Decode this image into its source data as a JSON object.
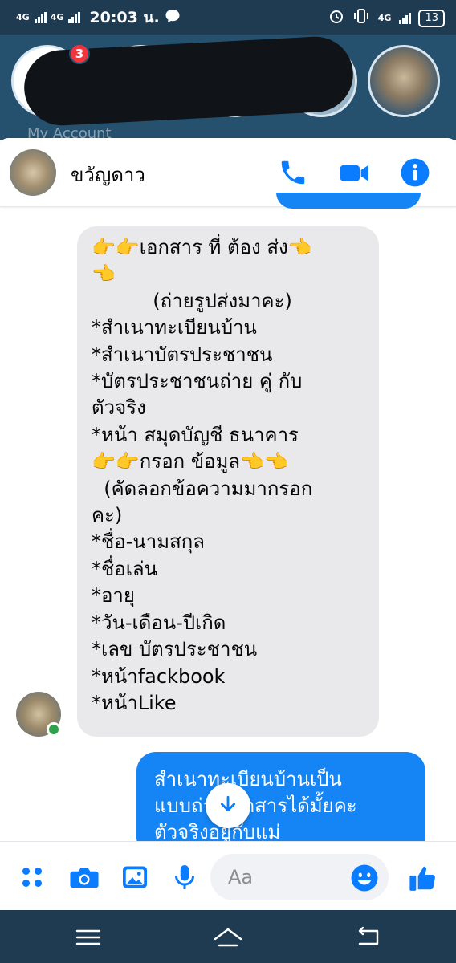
{
  "status_bar": {
    "network_1": "4G",
    "network_2": "4G",
    "time": "20:03 น.",
    "network_right": "4G",
    "battery": "13"
  },
  "stories": {
    "unread_badge": "3",
    "my_account_label": "My Account"
  },
  "chat": {
    "contact_name": "ขวัญดาว",
    "incoming_message": "👉👉เอกสาร ที่ ต้อง ส่ง👈\n👈\n          (ถ่ายรูปส่งมาคะ)\n*สำเนาทะเบียนบ้าน\n*สำเนาบัตรประชาชน\n*บัตรประชาชนถ่าย คู่ กับ\nตัวจริง\n*หน้า สมุดบัญชี ธนาคาร\n👉👉กรอก ข้อมูล👈👈\n  (คัดลอกข้อความมากรอก\nคะ)\n*ชื่อ-นามสกุล\n*ชื่อเล่น\n*อายุ\n*วัน-เดือน-ปีเกิด\n*เลข บัตรประชาชน\n*หน้าfackbook\n*หน้าLike",
    "outgoing_message": "สำเนาทะเบียนบ้านเป็น\nแบบถ่ายเอกสารได้มั้ยคะ\nตัวจริงอยู่กับแม่"
  },
  "composer": {
    "placeholder": "Aa"
  },
  "colors": {
    "messenger_blue": "#1585f5",
    "status_bar_bg": "#1f3b52",
    "incoming_bubble": "#e9e9eb",
    "online_green": "#31a24c",
    "badge_red": "#f0353f"
  },
  "icons": [
    "signal-icon",
    "message-icon",
    "alarm-icon",
    "vibrate-icon",
    "battery-icon",
    "phone-call-icon",
    "video-call-icon",
    "info-icon",
    "arrow-down-icon",
    "apps-icon",
    "camera-icon",
    "gallery-icon",
    "microphone-icon",
    "emoji-icon",
    "thumbs-up-icon",
    "menu-icon",
    "home-icon",
    "back-icon"
  ]
}
